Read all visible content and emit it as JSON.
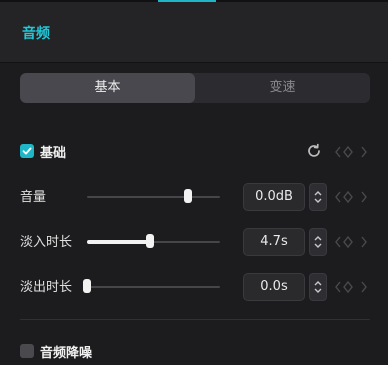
{
  "header": {
    "title": "音频"
  },
  "tabs": [
    {
      "label": "基本",
      "active": true
    },
    {
      "label": "变速",
      "active": false
    }
  ],
  "basic_section": {
    "label": "基础",
    "checked": true,
    "params": [
      {
        "label": "音量",
        "value": "0.0dB",
        "level": 0.76
      },
      {
        "label": "淡入时长",
        "value": "4.7s",
        "level": 0.47
      },
      {
        "label": "淡出时长",
        "value": "0.0s",
        "level": 0.0
      }
    ]
  },
  "noise_section": {
    "label": "音频降噪",
    "checked": false
  },
  "icons": {
    "reset": "reset-icon",
    "keyframe_nav": "keyframe-nav-arrows-icon",
    "stepper": "stepper-icon",
    "check": "check-icon"
  },
  "colors": {
    "accent": "#1fb6c8",
    "background": "#1c1c1e",
    "header_bg": "#242427"
  }
}
